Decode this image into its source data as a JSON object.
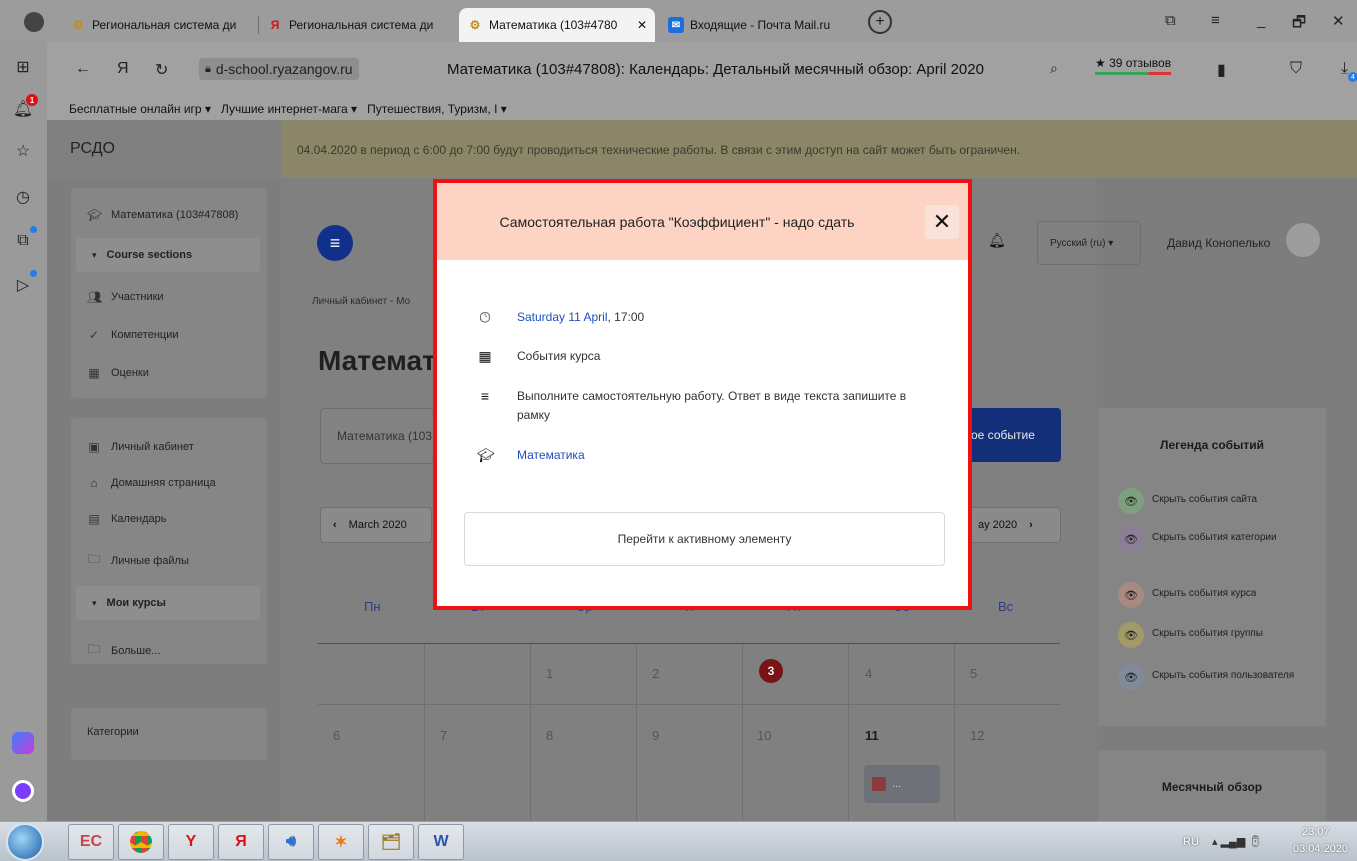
{
  "browser": {
    "tabs": [
      {
        "label": "Региональная система ди",
        "icon": "gear-icon",
        "active": false
      },
      {
        "label": "Региональная система ди",
        "icon": "yandex-icon",
        "active": false
      },
      {
        "label": "Математика (103#4780",
        "icon": "gear-icon",
        "active": true
      },
      {
        "label": "Входящие - Почта Mail.ru",
        "icon": "mail-icon",
        "active": false
      }
    ],
    "url_host": "d-school.ryazangov.ru",
    "page_heading": "Математика (103#47808): Календарь: Детальный месячный обзор: April 2020",
    "reviews": "★ 39 отзывов",
    "bookmarks": [
      "Бесплатные онлайн игр ▾",
      "Лучшие интернет-мага ▾",
      "Путешествия, Туризм, I ▾"
    ],
    "rail_badge": "1",
    "download_badge": "4"
  },
  "site": {
    "brand": "РСДО",
    "notice": "04.04.2020 в период с 6:00 до 7:00 будут проводиться технические работы. В связи с этим доступ на сайт может быть ограничен.",
    "sidebar": {
      "course_name": "Математика (103#47808)",
      "course_sections": "Course sections",
      "participants": "Участники",
      "competencies": "Компетенции",
      "grades": "Оценки",
      "dashboard": "Личный кабинет",
      "home": "Домашняя страница",
      "calendar": "Календарь",
      "private_files": "Личные файлы",
      "my_courses": "Мои курсы",
      "more": "Больше...",
      "categories": "Категории"
    },
    "header": {
      "language": "Русский (ru) ▾",
      "user_name": "Давид Конопелько"
    },
    "breadcrumb": "Личный кабинет - Мо",
    "title": "Математ",
    "course_select": "Математика (103",
    "new_event": "ое событие",
    "prev_month": "March 2020",
    "next_month": "ay 2020",
    "calendar": {
      "days": [
        "Пн",
        "Вт",
        "Ср",
        "Чт",
        "Пт",
        "Сб",
        "Вс"
      ],
      "week1": [
        "",
        "",
        "1",
        "2",
        "3",
        "4",
        "5"
      ],
      "week2": [
        "6",
        "7",
        "8",
        "9",
        "10",
        "11",
        "12"
      ],
      "event_chip": "..."
    },
    "legend": {
      "title": "Легенда событий",
      "items": [
        {
          "label": "Скрыть события сайта",
          "color": "#7fa07f"
        },
        {
          "label": "Скрыть события категории",
          "color": "#8a7f95"
        },
        {
          "label": "Скрыть события курса",
          "color": "#a88a80"
        },
        {
          "label": "Скрыть события группы",
          "color": "#a39a6a"
        },
        {
          "label": "Скрыть события пользователя",
          "color": "#7f8a9a"
        }
      ]
    },
    "month_overview": "Месячный обзор"
  },
  "modal": {
    "title": "Самостоятельная работа \"Коэффициент\" - надо сдать",
    "date_link": "Saturday 11 April",
    "time": ", 17:00",
    "event_type": "События курса",
    "description": "Выполните самостоятельную работу. Ответ в виде текста запишите в рамку",
    "course_link": "Математика",
    "action_button": "Перейти к активному элементу",
    "accent_color": "#ee1111"
  },
  "taskbar": {
    "lang": "RU",
    "time": "23:07",
    "date": "03.04.2020"
  }
}
